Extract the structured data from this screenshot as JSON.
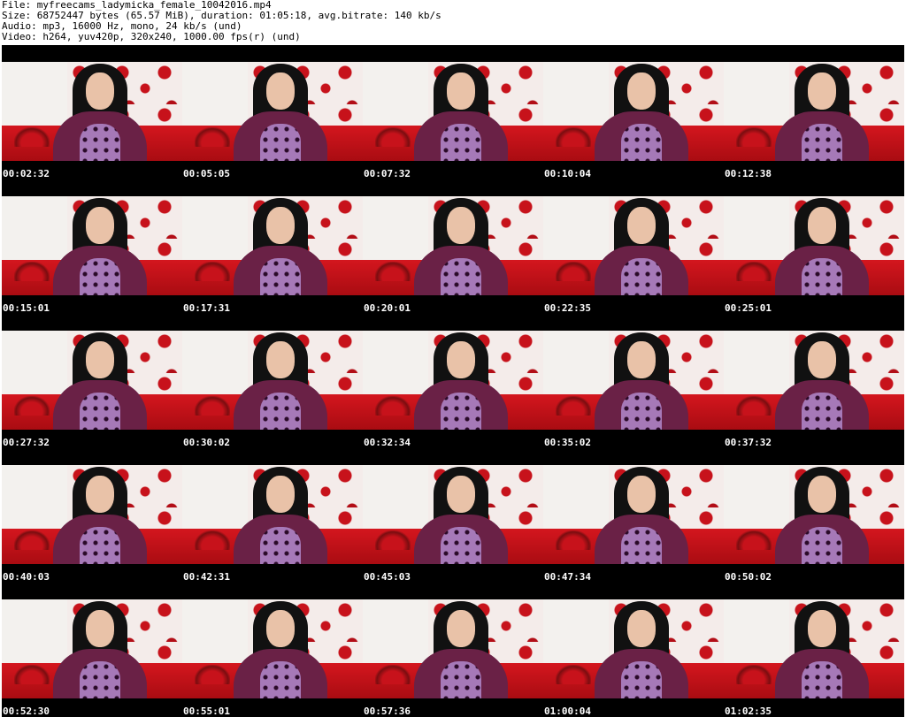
{
  "header": {
    "file": "File: myfreecams_ladymicka_female_10042016.mp4",
    "size": "Size: 68752447 bytes (65.57 MiB), duration: 01:05:18, avg.bitrate: 140 kb/s",
    "audio": "Audio: mp3, 16000 Hz, mono, 24 kb/s (und)",
    "video": "Video: h264, yuv420p, 320x240, 1000.00 fps(r) (und)"
  },
  "thumbnails": [
    {
      "timestamp": "00:02:32"
    },
    {
      "timestamp": "00:05:05"
    },
    {
      "timestamp": "00:07:32"
    },
    {
      "timestamp": "00:10:04"
    },
    {
      "timestamp": "00:12:38"
    },
    {
      "timestamp": "00:15:01"
    },
    {
      "timestamp": "00:17:31"
    },
    {
      "timestamp": "00:20:01"
    },
    {
      "timestamp": "00:22:35"
    },
    {
      "timestamp": "00:25:01"
    },
    {
      "timestamp": "00:27:32"
    },
    {
      "timestamp": "00:30:02"
    },
    {
      "timestamp": "00:32:34"
    },
    {
      "timestamp": "00:35:02"
    },
    {
      "timestamp": "00:37:32"
    },
    {
      "timestamp": "00:40:03"
    },
    {
      "timestamp": "00:42:31"
    },
    {
      "timestamp": "00:45:03"
    },
    {
      "timestamp": "00:47:34"
    },
    {
      "timestamp": "00:50:02"
    },
    {
      "timestamp": "00:52:30"
    },
    {
      "timestamp": "00:55:01"
    },
    {
      "timestamp": "00:57:36"
    },
    {
      "timestamp": "01:00:04"
    },
    {
      "timestamp": "01:02:35"
    }
  ]
}
